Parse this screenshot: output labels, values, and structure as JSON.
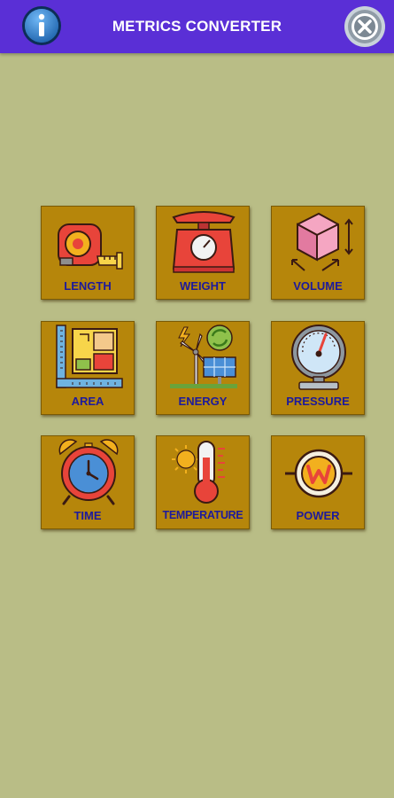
{
  "app": {
    "title": "METRICS CONVERTER"
  },
  "toolbar": {
    "info_icon": "info-icon",
    "close_icon": "close-icon"
  },
  "colors": {
    "topbar": "#5a2fd6",
    "background": "#b9bd86",
    "tile": "#b6860b",
    "label": "#1d1a9c"
  },
  "categories": [
    {
      "label": "LENGTH",
      "icon": "tape-measure-icon"
    },
    {
      "label": "WEIGHT",
      "icon": "kitchen-scale-icon"
    },
    {
      "label": "VOLUME",
      "icon": "cube-icon"
    },
    {
      "label": "AREA",
      "icon": "floor-plan-icon"
    },
    {
      "label": "ENERGY",
      "icon": "wind-solar-icon"
    },
    {
      "label": "PRESSURE",
      "icon": "pressure-gauge-icon"
    },
    {
      "label": "TIME",
      "icon": "alarm-clock-icon"
    },
    {
      "label": "TEMPERATURE",
      "icon": "thermometer-icon"
    },
    {
      "label": "POWER",
      "icon": "power-w-icon"
    }
  ]
}
